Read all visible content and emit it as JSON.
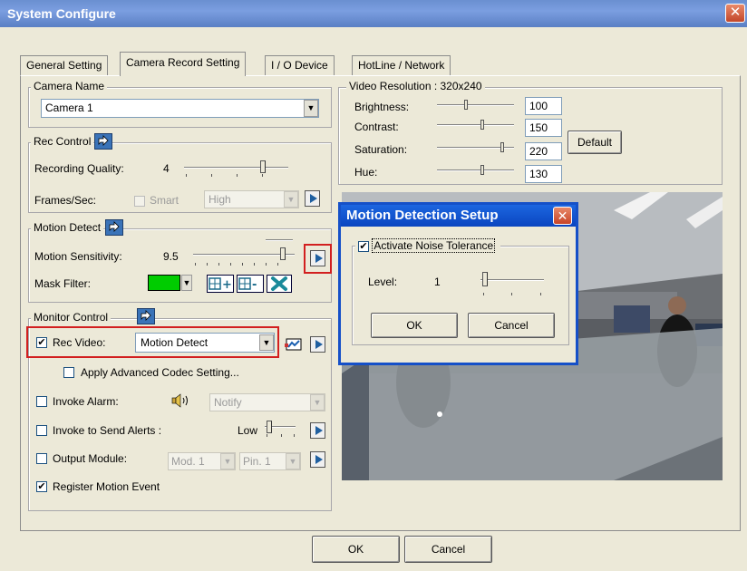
{
  "window": {
    "title": "System Configure",
    "close_glyph": "✕"
  },
  "tabs": [
    {
      "label": "General Setting",
      "active": false
    },
    {
      "label": "Camera Record Setting",
      "active": true
    },
    {
      "label": "I / O Device",
      "active": false
    },
    {
      "label": "HotLine / Network",
      "active": false
    }
  ],
  "camera_name": {
    "legend": "Camera Name",
    "value": "Camera 1"
  },
  "rec_control": {
    "legend": "Rec Control",
    "quality_label": "Recording Quality:",
    "quality_value": "4",
    "fps_label": "Frames/Sec:",
    "smart_label": "Smart",
    "fps_select": "High"
  },
  "motion_detect": {
    "legend": "Motion Detect",
    "sensitivity_label": "Motion Sensitivity:",
    "sensitivity_value": "9.5",
    "mask_label": "Mask Filter:",
    "mask_color": "#00cc00"
  },
  "monitor_control": {
    "legend": "Monitor Control",
    "rec_video_label": "Rec Video:",
    "rec_video_checked": true,
    "rec_video_select": "Motion Detect",
    "advanced_codec_label": "Apply Advanced Codec Setting...",
    "invoke_alarm_label": "Invoke Alarm:",
    "alarm_select": "Notify",
    "send_alerts_label": "Invoke to Send Alerts :",
    "alerts_level": "Low",
    "output_module_label": "Output Module:",
    "module_select": "Mod. 1",
    "pin_select": "Pin. 1",
    "register_label": "Register Motion Event",
    "register_checked": true
  },
  "video_resolution": {
    "legend": "Video Resolution : 320x240",
    "brightness_label": "Brightness:",
    "brightness": "100",
    "contrast_label": "Contrast:",
    "contrast": "150",
    "saturation_label": "Saturation:",
    "saturation": "220",
    "hue_label": "Hue:",
    "hue": "130",
    "default_label": "Default"
  },
  "motion_dialog": {
    "title": "Motion Detection Setup",
    "noise_label": "Activate Noise Tolerance",
    "noise_checked": true,
    "level_label": "Level:",
    "level_value": "1",
    "ok_label": "OK",
    "cancel_label": "Cancel"
  },
  "footer": {
    "ok_label": "OK",
    "cancel_label": "Cancel"
  }
}
